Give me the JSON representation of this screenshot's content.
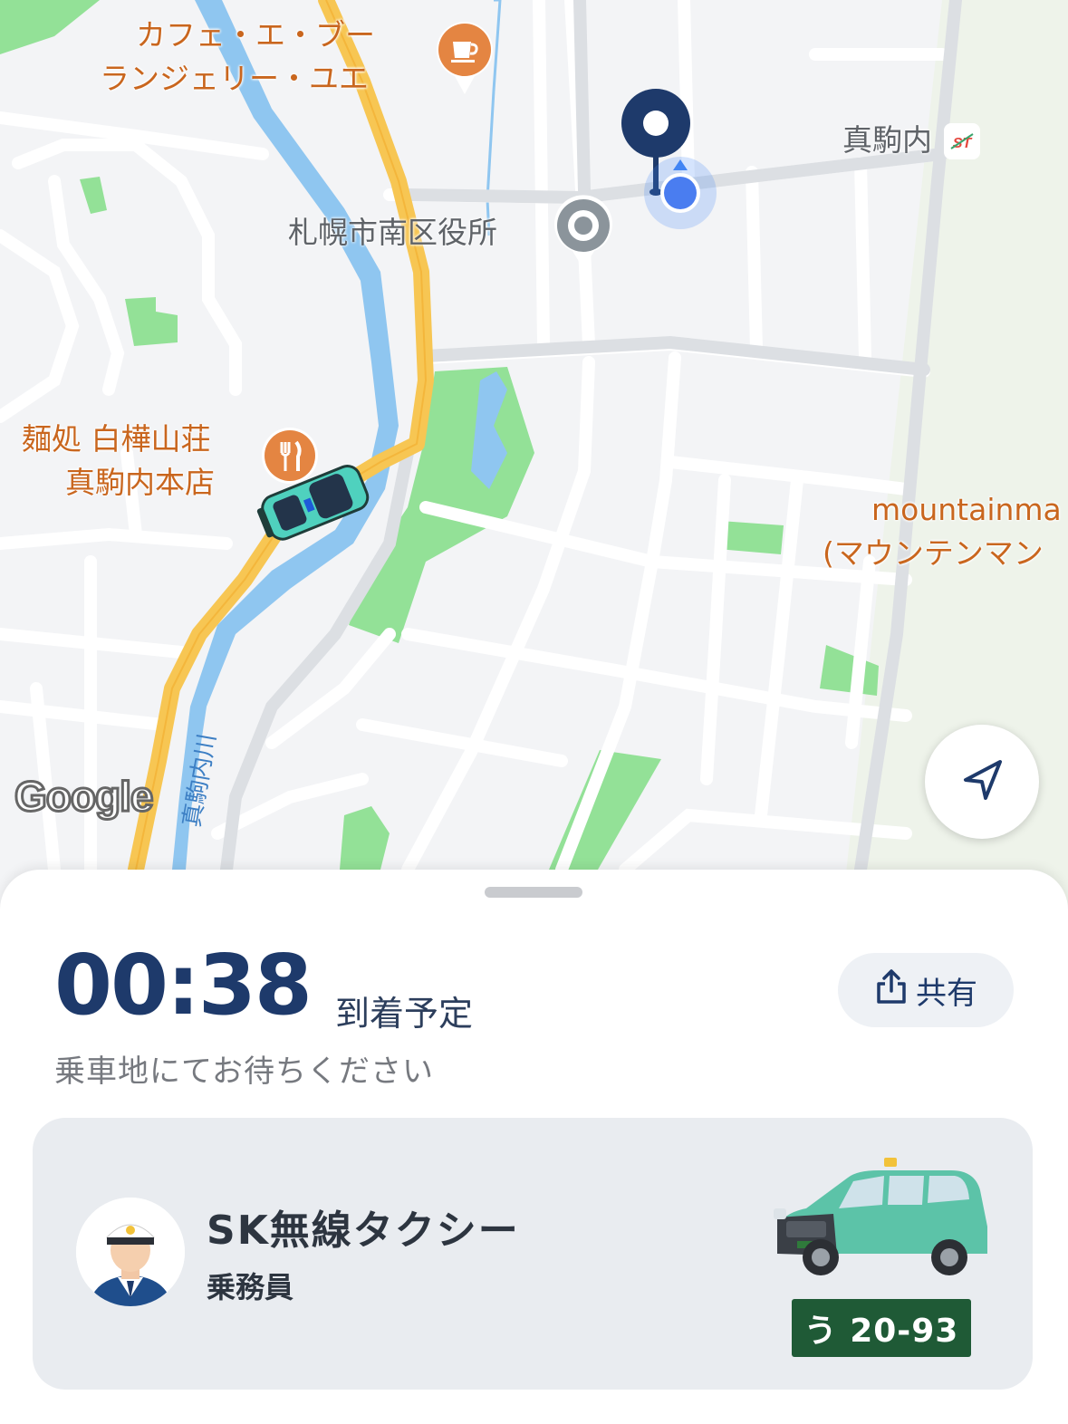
{
  "map": {
    "poi_cafe": {
      "line1": "カフェ・エ・ブー",
      "line2": "ランジェリー・ユエ",
      "icon": "coffee-cup-icon"
    },
    "poi_restaurant": {
      "line1": "麺処 白樺山荘",
      "line2": "真駒内本店",
      "icon": "fork-knife-icon"
    },
    "poi_office": {
      "label": "札幌市南区役所",
      "icon": "landmark-icon"
    },
    "poi_station": {
      "label": "真駒内",
      "icon": "subway-station-icon"
    },
    "poi_mountain": {
      "line1": "mountainma",
      "line2": "(マウンテンマン"
    },
    "river_label": "真駒内川",
    "google_logo": "Google",
    "colors": {
      "park": "#93e197",
      "river": "#8fc6f0",
      "main_road": "#f7c653",
      "road": "#ffffff",
      "background": "#f3f4f6"
    }
  },
  "bottom_sheet": {
    "eta_time": "00:38",
    "eta_label": "到着予定",
    "instruction": "乗車地にてお待ちください",
    "share_label": "共有",
    "driver_card": {
      "company": "SK無線タクシー",
      "role": "乗務員",
      "plate": "う 20-93"
    }
  }
}
